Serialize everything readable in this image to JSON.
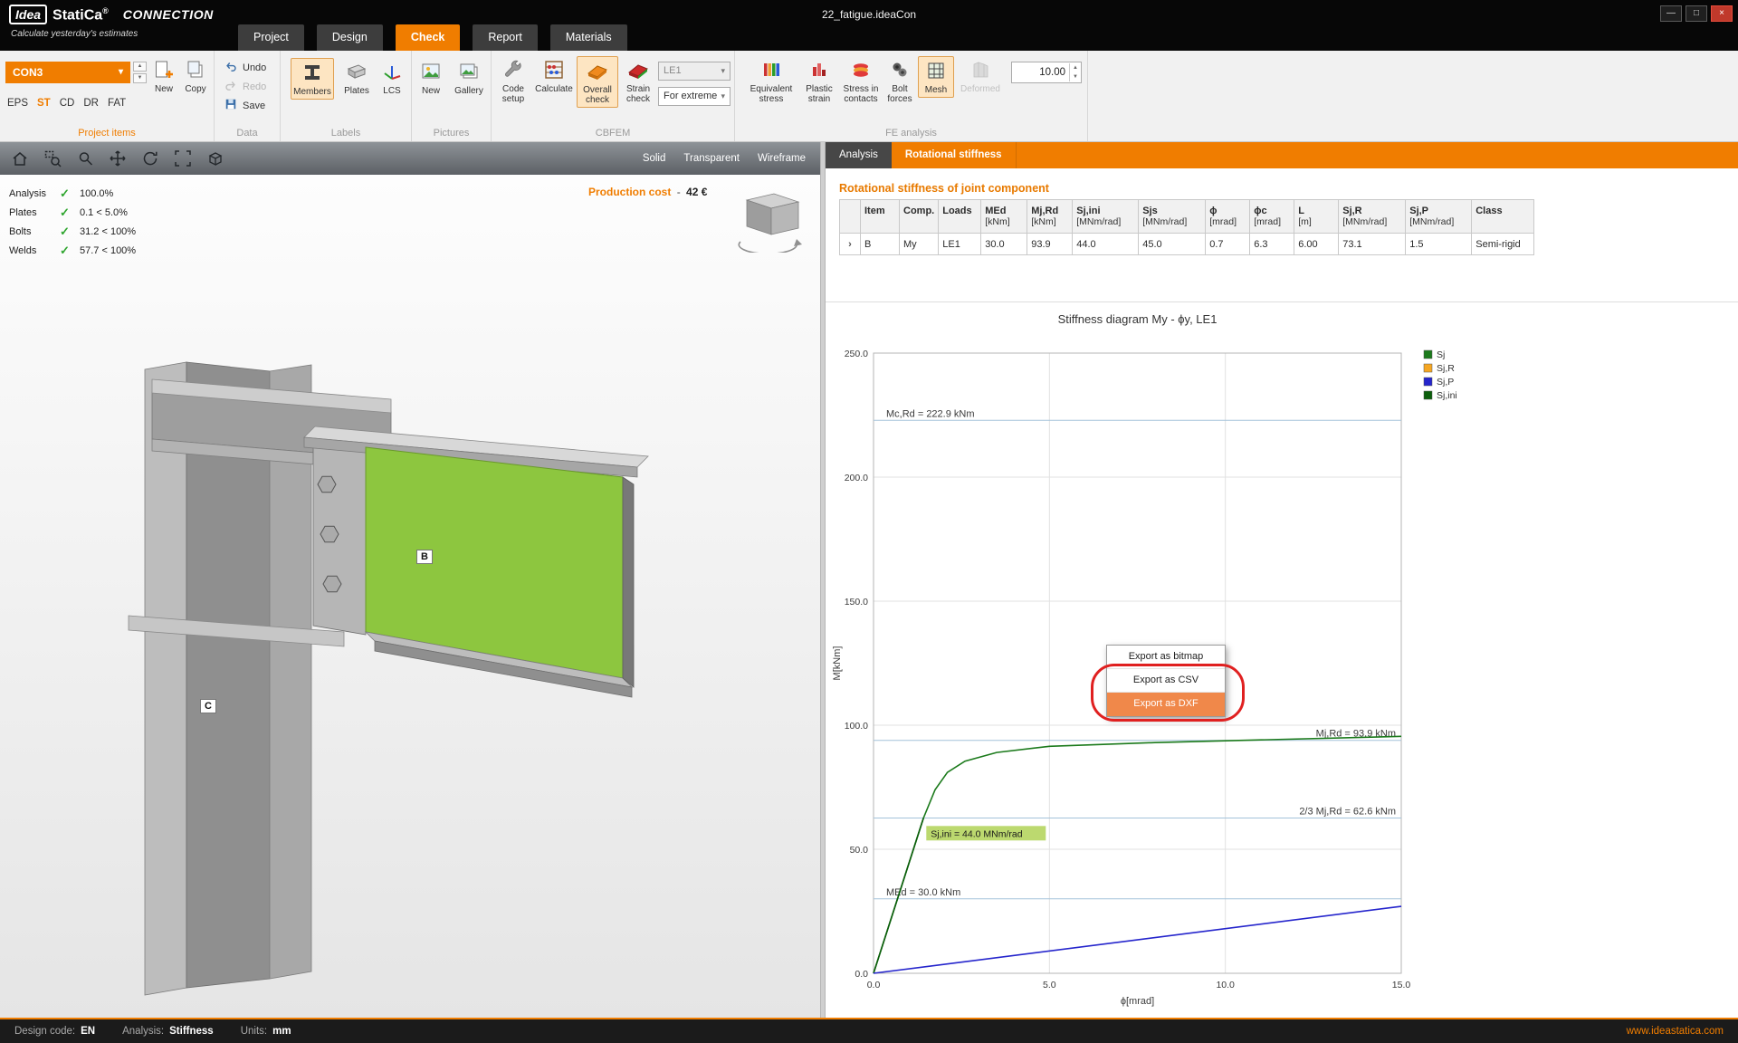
{
  "icons": {
    "check": "✓",
    "chevron_down": "▾",
    "spin_up": "▲",
    "spin_down": "▼",
    "row_expander": "›",
    "minimize": "—",
    "maximize": "□",
    "close": "×"
  },
  "titlebar": {
    "logo_idea": "Idea",
    "logo_statica": "StatiCa",
    "logo_reg": "®",
    "logo_product": "CONNECTION",
    "tagline": "Calculate yesterday's estimates",
    "window_title": "22_fatigue.ideaCon"
  },
  "ribbon_tabs": [
    {
      "label": "Project"
    },
    {
      "label": "Design"
    },
    {
      "label": "Check"
    },
    {
      "label": "Report"
    },
    {
      "label": "Materials"
    }
  ],
  "ribbon": {
    "project_items": {
      "group_label": "Project items",
      "combo_value": "CON3",
      "new_label": "New",
      "copy_label": "Copy",
      "modes": [
        "EPS",
        "ST",
        "CD",
        "DR",
        "FAT"
      ]
    },
    "data_group": {
      "group_label": "Data",
      "undo": "Undo",
      "redo": "Redo",
      "save": "Save"
    },
    "labels_group": {
      "group_label": "Labels",
      "members": "Members",
      "plates": "Plates",
      "lcs": "LCS"
    },
    "pictures_group": {
      "group_label": "Pictures",
      "new": "New",
      "gallery": "Gallery"
    },
    "cbfem_group": {
      "group_label": "CBFEM",
      "code_setup": "Code setup",
      "calculate": "Calculate",
      "overall_check": "Overall check",
      "strain_check": "Strain check",
      "load_case": "LE1",
      "extreme": "For extreme"
    },
    "fe_group": {
      "group_label": "FE analysis",
      "equivalent_stress": "Equivalent stress",
      "plastic_strain": "Plastic strain",
      "stress_in_contacts": "Stress in contacts",
      "bolt_forces": "Bolt forces",
      "mesh": "Mesh",
      "deformed": "Deformed",
      "scale_value": "10.00"
    }
  },
  "viewport": {
    "view_modes": [
      "Solid",
      "Transparent",
      "Wireframe"
    ],
    "checks": [
      {
        "name": "Analysis",
        "value": "100.0%"
      },
      {
        "name": "Plates",
        "value": "0.1 < 5.0%"
      },
      {
        "name": "Bolts",
        "value": "31.2 < 100%"
      },
      {
        "name": "Welds",
        "value": "57.7 < 100%"
      }
    ],
    "production_cost_label": "Production cost",
    "production_cost_sep": "-",
    "production_cost_amount": "42 €",
    "label_b": "B",
    "label_c": "C"
  },
  "results": {
    "tab_analysis": "Analysis",
    "tab_rotational": "Rotational stiffness",
    "section_title": "Rotational stiffness of joint component",
    "table": {
      "headers": [
        {
          "name": "Item",
          "unit": ""
        },
        {
          "name": "Comp.",
          "unit": ""
        },
        {
          "name": "Loads",
          "unit": ""
        },
        {
          "name": "MEd",
          "unit": "[kNm]"
        },
        {
          "name": "Mj,Rd",
          "unit": "[kNm]"
        },
        {
          "name": "Sj,ini",
          "unit": "[MNm/rad]"
        },
        {
          "name": "Sjs",
          "unit": "[MNm/rad]"
        },
        {
          "name": "ϕ",
          "unit": "[mrad]"
        },
        {
          "name": "ϕc",
          "unit": "[mrad]"
        },
        {
          "name": "L",
          "unit": "[m]"
        },
        {
          "name": "Sj,R",
          "unit": "[MNm/rad]"
        },
        {
          "name": "Sj,P",
          "unit": "[MNm/rad]"
        },
        {
          "name": "Class",
          "unit": ""
        }
      ],
      "rows": [
        [
          "B",
          "My",
          "LE1",
          "30.0",
          "93.9",
          "44.0",
          "45.0",
          "0.7",
          "6.3",
          "6.00",
          "73.1",
          "1.5",
          "Semi-rigid"
        ]
      ]
    }
  },
  "chart_data": {
    "type": "line",
    "title": "Stiffness diagram My - ϕy, LE1",
    "xlabel": "ϕ[mrad]",
    "ylabel": "M[kNm]",
    "xlim": [
      0,
      15
    ],
    "ylim": [
      0,
      250
    ],
    "x_ticks": [
      "0.0",
      "5.0",
      "10.0",
      "15.0"
    ],
    "y_ticks": [
      "0.0",
      "50.0",
      "100.0",
      "150.0",
      "200.0",
      "250.0"
    ],
    "grid": true,
    "legend_position": "right-top",
    "legend": [
      {
        "name": "Sj",
        "color": "#1b7a1b"
      },
      {
        "name": "Sj,R",
        "color": "#f5a623"
      },
      {
        "name": "Sj,P",
        "color": "#2525cc"
      },
      {
        "name": "Sj,ini",
        "color": "#0b5e0b"
      }
    ],
    "reference_lines": [
      {
        "label": "Mc,Rd = 222.9 kNm",
        "value": 222.9,
        "side": "left"
      },
      {
        "label": "Mj,Rd = 93.9 kNm",
        "value": 93.9,
        "side": "right"
      },
      {
        "label": "2/3 Mj,Rd = 62.6 kNm",
        "value": 62.6,
        "side": "right"
      },
      {
        "label": "MEd = 30.0 kNm",
        "value": 30.0,
        "side": "left"
      }
    ],
    "series": [
      {
        "name": "Sj",
        "color": "#1b7a1b",
        "points": [
          [
            0,
            0
          ],
          [
            0.7,
            30.8
          ],
          [
            1.42,
            62.6
          ],
          [
            1.75,
            74
          ],
          [
            2.1,
            81
          ],
          [
            2.6,
            85.5
          ],
          [
            3.5,
            89
          ],
          [
            5,
            91.5
          ],
          [
            8,
            93
          ],
          [
            15,
            95.5
          ]
        ]
      },
      {
        "name": "Sj,ini",
        "color": "#0b5e0b",
        "points": [
          [
            0,
            0
          ],
          [
            1.42,
            62.6
          ]
        ]
      },
      {
        "name": "Sj,P",
        "color": "#2525cc",
        "points": [
          [
            0,
            0
          ],
          [
            15,
            27
          ]
        ]
      }
    ],
    "annotation": {
      "text": "Sj,ini = 44.0 MNm/rad",
      "x": 1.5,
      "y": 55,
      "bg": "#bcd96f"
    }
  },
  "context_menu": {
    "items": [
      "Export as bitmap",
      "Export as CSV",
      "Export as DXF"
    ],
    "highlighted_index": 2
  },
  "statusbar": {
    "design_code_label": "Design code:",
    "design_code_value": "EN",
    "analysis_label": "Analysis:",
    "analysis_value": "Stiffness",
    "units_label": "Units:",
    "units_value": "mm",
    "website": "www.ideastatica.com"
  },
  "colors": {
    "accent": "#f07d00",
    "member_green": "#8dc63f",
    "check_green": "#2ea52e",
    "annotation_red": "#e02020"
  }
}
